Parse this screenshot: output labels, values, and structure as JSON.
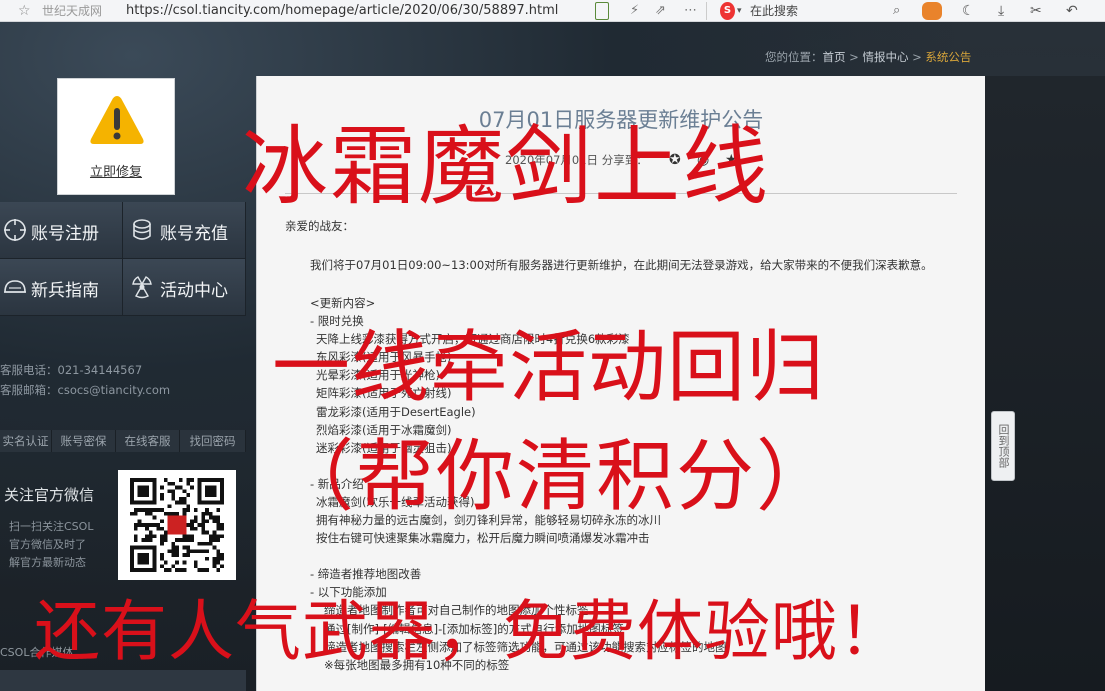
{
  "browser": {
    "site_name": "世纪天成网",
    "url": "https://csol.tiancity.com/homepage/article/2020/06/30/58897.html",
    "search_placeholder": "在此搜索"
  },
  "breadcrumb": {
    "prefix": "您的位置：",
    "home": "首页",
    "sep": " > ",
    "section": "情报中心",
    "current": "系统公告"
  },
  "sidebar": {
    "repair_label": "立即修复",
    "nav": [
      {
        "label": "账号注册",
        "icon": "crosshair-icon"
      },
      {
        "label": "账号充值",
        "icon": "coin-icon"
      },
      {
        "label": "新兵指南",
        "icon": "helmet-icon"
      },
      {
        "label": "活动中心",
        "icon": "radiation-icon"
      }
    ],
    "phone": "客服电话：021-34144567",
    "email": "客服邮箱：csocs@tiancity.com",
    "links": [
      "实名认证",
      "账号密保",
      "在线客服",
      "找回密码"
    ],
    "wechat_title": "关注官方微信",
    "wechat_desc": [
      "扫一扫关注CSOL",
      "官方微信及时了",
      "解官方最新动态"
    ],
    "partner_label": "CSOL合作媒体"
  },
  "article": {
    "title": "07月01日服务器更新维护公告",
    "meta": "2020年07月01日  分享到：",
    "greeting": "亲爱的战友：",
    "notice": "我们将于07月01日09:00~13:00对所有服务器进行更新维护，在此期间无法登录游戏，给大家带来的不便我们深表歉意。",
    "lines": [
      {
        "text": "<更新内容>",
        "level": 0
      },
      {
        "text": "- 限时兑换",
        "level": 0
      },
      {
        "text": "天降上线彩漆获得方式开启，可通过商店限时4折兑换6款彩漆",
        "level": 1
      },
      {
        "text": "东风彩漆(适用于风暴手枪)",
        "level": 1
      },
      {
        "text": "光晕彩漆(适用于光神枪)",
        "level": 1
      },
      {
        "text": "矩阵彩漆(适用于死亡射线)",
        "level": 1
      },
      {
        "text": "雷龙彩漆(适用于DesertEagle)",
        "level": 1
      },
      {
        "text": "烈焰彩漆(适用于冰霜魔剑)",
        "level": 1
      },
      {
        "text": "迷彩彩漆(适用于幽灵狙击)",
        "level": 1
      },
      {
        "text": "",
        "level": -1
      },
      {
        "text": "- 新品介绍",
        "level": 0
      },
      {
        "text": "冰霜魔剑(欢乐一线牵活动获得)",
        "level": 1
      },
      {
        "text": "拥有神秘力量的远古魔剑，剑刃锋利异常，能够轻易切碎永冻的冰川",
        "level": 1
      },
      {
        "text": "按住右键可快速聚集冰霜魔力，松开后魔力瞬间喷涌爆发冰霜冲击",
        "level": 1
      },
      {
        "text": "",
        "level": -1
      },
      {
        "text": "- 缔造者推荐地图改善",
        "level": 0
      },
      {
        "text": "- 以下功能添加",
        "level": 0
      },
      {
        "text": "缔造者地图制作者可对自己制作的地图添加个性标签",
        "level": 2
      },
      {
        "text": "通过[制作]-[编辑信息]-[添加标签]的方式自行添加地图标签",
        "level": 2
      },
      {
        "text": "缔造者地图搜索栏左侧添加了标签筛选功能，可通过该功能搜索对应标签的地图",
        "level": 2
      },
      {
        "text": "※每张地图最多拥有10种不同的标签",
        "level": 2
      }
    ]
  },
  "scroll_top_label": "回到顶部",
  "overlay": {
    "line1": "冰霜魔剑上线",
    "line2": "一线牵活动回归",
    "line3": "（帮你清积分）",
    "line4": "还有人气武器，免费体验哦！"
  },
  "colors": {
    "overlay_red": "#d9101a",
    "breadcrumb_current": "#d8a53a",
    "title_blue": "#6b7f94"
  }
}
